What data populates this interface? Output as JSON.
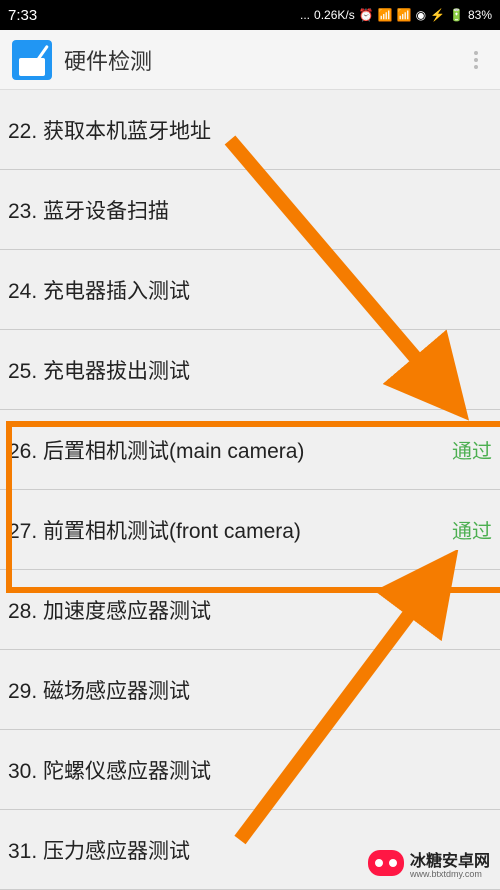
{
  "statusBar": {
    "time": "7:33",
    "speed": "0.26K/s",
    "battery": "83%"
  },
  "appBar": {
    "title": "硬件检测"
  },
  "items": [
    {
      "num": "22.",
      "label": "获取本机蓝牙地址",
      "status": ""
    },
    {
      "num": "23.",
      "label": "蓝牙设备扫描",
      "status": ""
    },
    {
      "num": "24.",
      "label": "充电器插入测试",
      "status": ""
    },
    {
      "num": "25.",
      "label": "充电器拔出测试",
      "status": ""
    },
    {
      "num": "26.",
      "label": "后置相机测试(main camera)",
      "status": "通过"
    },
    {
      "num": "27.",
      "label": "前置相机测试(front camera)",
      "status": "通过"
    },
    {
      "num": "28.",
      "label": "加速度感应器测试",
      "status": ""
    },
    {
      "num": "29.",
      "label": "磁场感应器测试",
      "status": ""
    },
    {
      "num": "30.",
      "label": "陀螺仪感应器测试",
      "status": ""
    },
    {
      "num": "31.",
      "label": "压力感应器测试",
      "status": ""
    }
  ],
  "watermark": {
    "text": "冰糖安卓网",
    "sub": "www.btxtdmy.com"
  },
  "colors": {
    "highlight": "#f57c00",
    "pass": "#4CAF50"
  }
}
